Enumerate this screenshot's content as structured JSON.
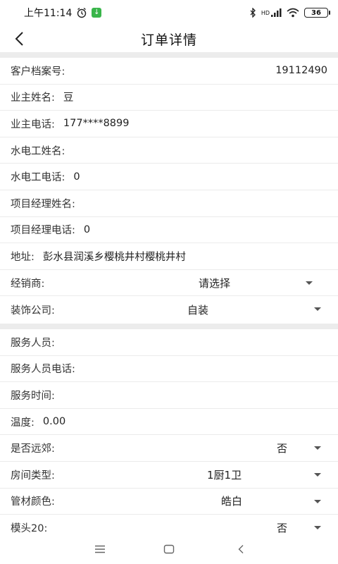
{
  "status_bar": {
    "time": "上午11:14",
    "download_glyph": "↓",
    "network": "HD",
    "battery": "36"
  },
  "header": {
    "title": "订单详情"
  },
  "section1": [
    {
      "label": "客户档案号:",
      "value": "19112490",
      "align": "right"
    },
    {
      "label": "业主姓名:",
      "value": "豆"
    },
    {
      "label": "业主电话:",
      "value": "177****8899"
    },
    {
      "label": "水电工姓名:",
      "value": ""
    },
    {
      "label": "水电工电话:",
      "value": "0"
    },
    {
      "label": "项目经理姓名:",
      "value": ""
    },
    {
      "label": "项目经理电话:",
      "value": "0"
    },
    {
      "label": "地址:",
      "value": "彭水县润溪乡樱桃井村樱桃井村"
    }
  ],
  "selects1": [
    {
      "label": "经销商:",
      "value": "请选择"
    },
    {
      "label": "装饰公司:",
      "value": "自装"
    }
  ],
  "section2": [
    {
      "label": "服务人员:",
      "value": ""
    },
    {
      "label": "服务人员电话:",
      "value": ""
    },
    {
      "label": "服务时间:",
      "value": ""
    },
    {
      "label": "温度:",
      "value": "0.00"
    }
  ],
  "selects2": [
    {
      "label": "是否远郊:",
      "value": "否"
    },
    {
      "label": "房间类型:",
      "value": "1厨1卫"
    },
    {
      "label": "管材颜色:",
      "value": "皓白"
    },
    {
      "label": "模头20:",
      "value": "否"
    }
  ],
  "icons": {
    "back": "back-arrow-icon",
    "menu": "menu-icon",
    "home": "home-icon",
    "back_nav": "back-nav-icon"
  }
}
